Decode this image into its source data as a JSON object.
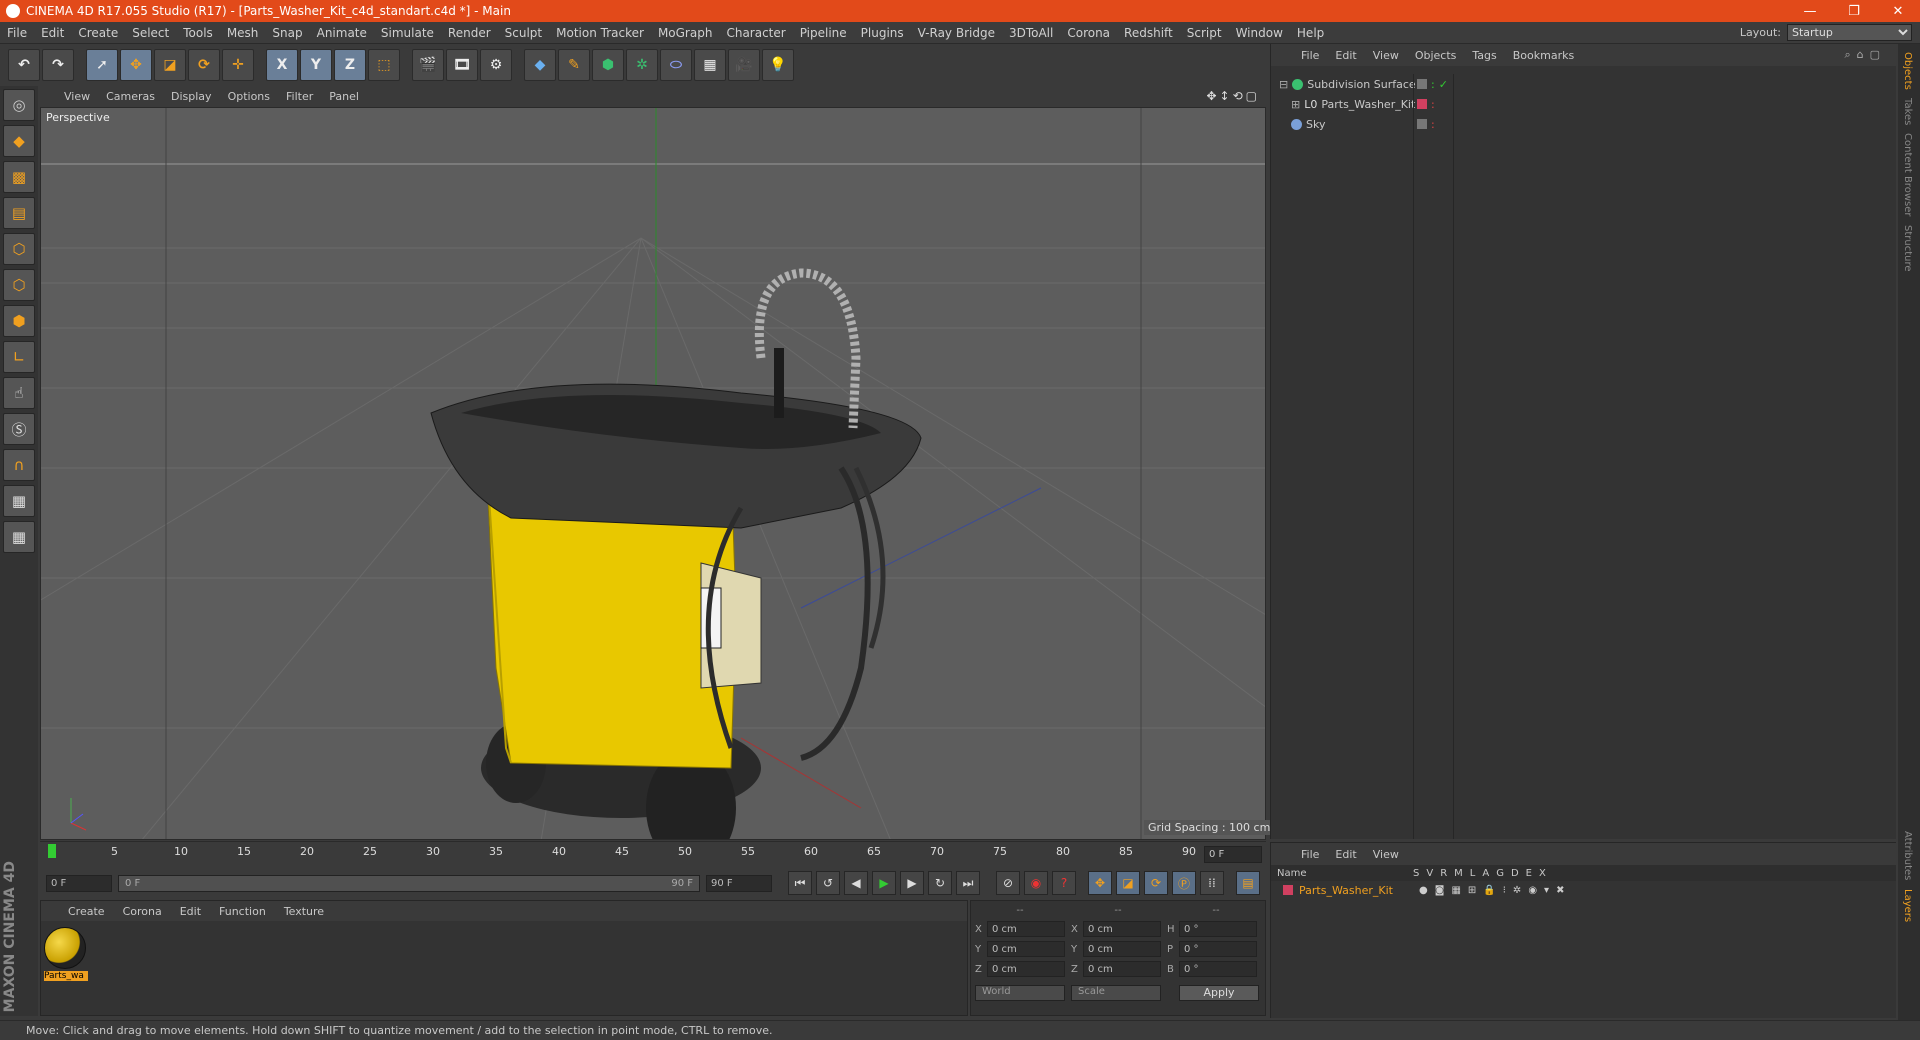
{
  "window": {
    "title": "CINEMA 4D R17.055 Studio (R17) - [Parts_Washer_Kit_c4d_standart.c4d *] - Main",
    "controls": [
      "—",
      "❐",
      "✕"
    ]
  },
  "menubar": {
    "items": [
      "File",
      "Edit",
      "Create",
      "Select",
      "Tools",
      "Mesh",
      "Snap",
      "Animate",
      "Simulate",
      "Render",
      "Sculpt",
      "Motion Tracker",
      "MoGraph",
      "Character",
      "Pipeline",
      "Plugins",
      "V-Ray Bridge",
      "3DToAll",
      "Corona",
      "Redshift",
      "Script",
      "Window",
      "Help"
    ],
    "layout_label": "Layout:",
    "layout_value": "Startup"
  },
  "toolbar": {
    "icons": [
      "undo-icon",
      "redo-icon",
      "select-arrow-icon",
      "move-icon",
      "scale-icon",
      "rotate-icon",
      "live-select-icon",
      "x-axis-icon",
      "y-axis-icon",
      "z-axis-icon",
      "coordinate-system-icon",
      "render-view-icon",
      "render-picture-viewer-icon",
      "edit-render-settings-icon",
      "cube-icon",
      "pen-icon",
      "subdivision-icon",
      "array-icon",
      "deformer-icon",
      "floor-icon",
      "camera-icon",
      "light-icon"
    ],
    "axis_labels": [
      "X",
      "Y",
      "Z"
    ]
  },
  "viewport": {
    "menu": [
      "View",
      "Cameras",
      "Display",
      "Options",
      "Filter",
      "Panel"
    ],
    "label": "Perspective",
    "grid_spacing": "Grid Spacing : 100 cm"
  },
  "timeline": {
    "ticks": [
      "0",
      "5",
      "10",
      "15",
      "20",
      "25",
      "30",
      "35",
      "40",
      "45",
      "50",
      "55",
      "60",
      "65",
      "70",
      "75",
      "80",
      "85",
      "90"
    ],
    "end_field": "0 F"
  },
  "transport": {
    "start": "0 F",
    "range_left": "0 F",
    "range_right": "90 F",
    "end": "90 F"
  },
  "material_manager": {
    "menu": [
      "Create",
      "Corona",
      "Edit",
      "Function",
      "Texture"
    ],
    "materials": [
      {
        "name": "Parts_wa"
      }
    ]
  },
  "coordinates": {
    "headers": [
      "--",
      "--",
      "--"
    ],
    "rows": [
      {
        "a": "X",
        "av": "0 cm",
        "b": "X",
        "bv": "0 cm",
        "c": "H",
        "cv": "0 °"
      },
      {
        "a": "Y",
        "av": "0 cm",
        "b": "Y",
        "bv": "0 cm",
        "c": "P",
        "cv": "0 °"
      },
      {
        "a": "Z",
        "av": "0 cm",
        "b": "Z",
        "bv": "0 cm",
        "c": "B",
        "cv": "0 °"
      }
    ],
    "mode1": "World",
    "mode2": "Scale",
    "apply": "Apply"
  },
  "object_manager": {
    "menu": [
      "File",
      "Edit",
      "View",
      "Objects",
      "Tags",
      "Bookmarks"
    ],
    "objects": [
      {
        "name": "Subdivision Surface",
        "color": "#3ac070",
        "level": 0
      },
      {
        "name": "Parts_Washer_Kit",
        "color": "#cfcfcf",
        "level": 1
      },
      {
        "name": "Sky",
        "color": "#7aa0d8",
        "level": 0
      }
    ]
  },
  "layer_manager": {
    "menu": [
      "File",
      "Edit",
      "View"
    ],
    "header_name": "Name",
    "columns": [
      "S",
      "V",
      "R",
      "M",
      "L",
      "A",
      "G",
      "D",
      "E",
      "X"
    ],
    "layers": [
      {
        "name": "Parts_Washer_Kit"
      }
    ]
  },
  "side_tabs": [
    "Objects",
    "Takes",
    "Content Browser",
    "Structure",
    "Attributes",
    "Layers"
  ],
  "brand": "MAXON CINEMA 4D",
  "statusbar": "Move: Click and drag to move elements. Hold down SHIFT to quantize movement / add to the selection in point mode, CTRL to remove.",
  "colors": {
    "accent": "#e24a1a",
    "highlight": "#f0a020",
    "body_yellow": "#e8c800"
  }
}
